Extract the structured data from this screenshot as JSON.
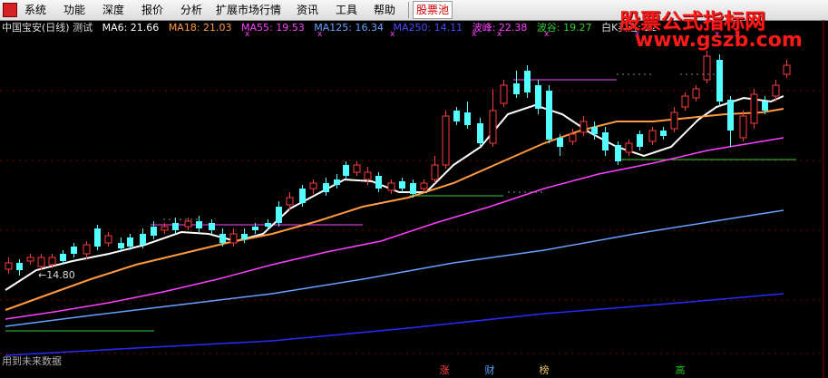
{
  "menu": {
    "items": [
      "系统",
      "功能",
      "深度",
      "报价",
      "分析",
      "扩展市场行情",
      "资讯",
      "工具",
      "帮助"
    ],
    "active_item": "股票池"
  },
  "watermark": {
    "title": "股票公式指标网",
    "url": "www.gszb.com"
  },
  "indicator_line": {
    "stock": "中国宝安(日线) 测试",
    "ma6": "MA6: 21.66",
    "ma18": "MA18: 21.03",
    "ma55": "MA55: 19.53",
    "ma125": "MA125: 16.34",
    "ma250": "MA250: 14.11",
    "peak": "波峰: 22.38",
    "trough": "波谷: 19.27",
    "bk": "白K买进: 22"
  },
  "chart": {
    "low_label": "←14.80",
    "footer": "用到未来数据",
    "bottom_tags": [
      {
        "text": "涨",
        "color": "#ff4444"
      },
      {
        "text": "财",
        "color": "#5aa0ff"
      },
      {
        "text": "榜",
        "color": "#e8c35a"
      },
      {
        "text": "高",
        "color": "#22c022"
      }
    ],
    "colors": {
      "up": "#ff3b3b",
      "down": "#54ffff",
      "ma6": "#ffffff",
      "ma18": "#ff9a40",
      "ma55": "#ff40ff",
      "ma125": "#6aa0ff",
      "ma250": "#2a2aff",
      "peak": "#ff40ff",
      "trough": "#33cc33"
    }
  }
}
